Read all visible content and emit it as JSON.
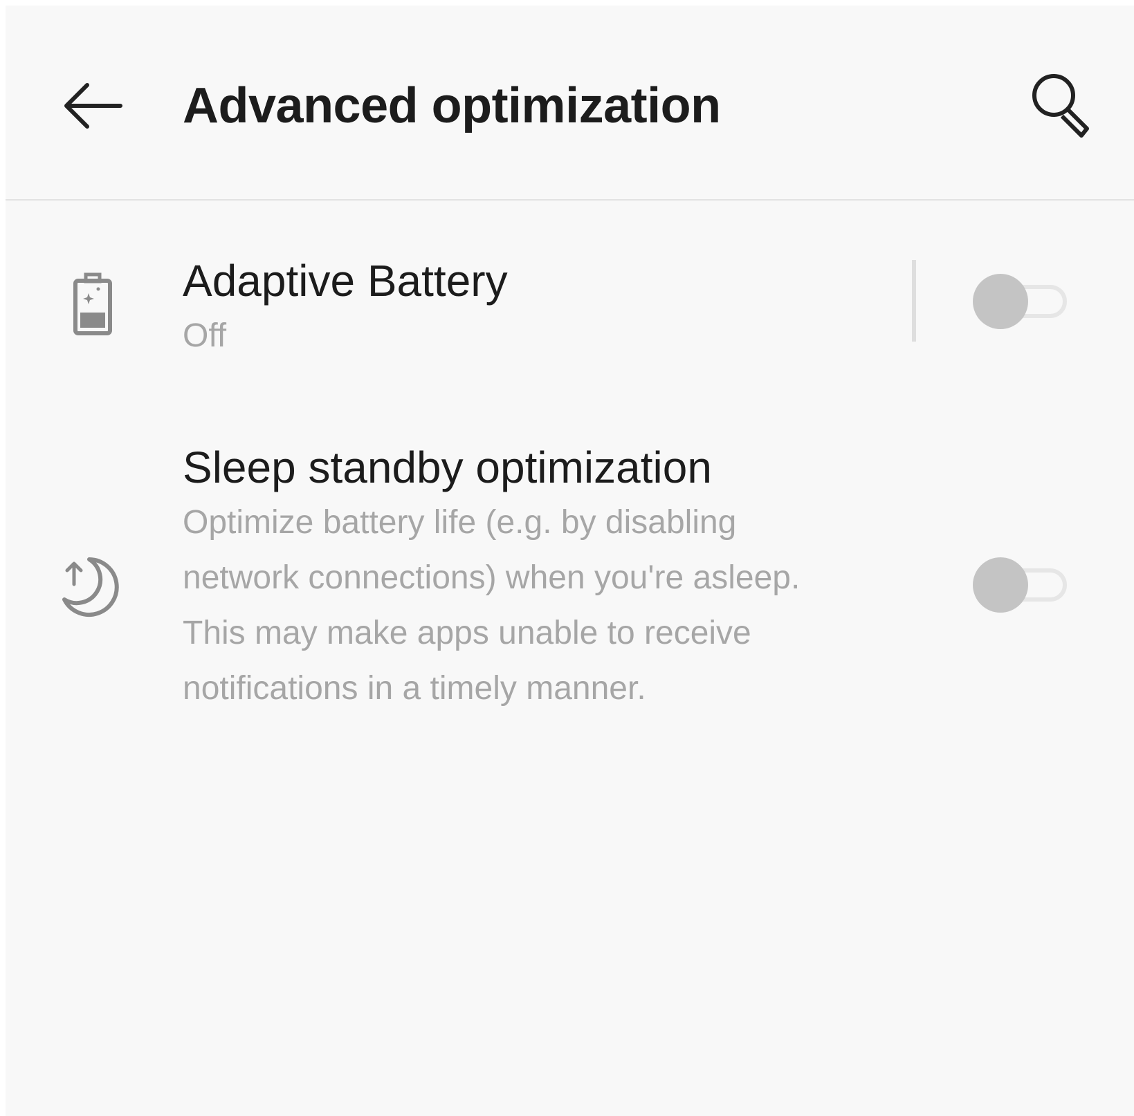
{
  "appbar": {
    "title": "Advanced optimization",
    "back_icon": "arrow-left-icon",
    "search_icon": "search-icon"
  },
  "settings": [
    {
      "title": "Adaptive Battery",
      "summary": "Off",
      "icon": "battery-icon",
      "toggle_on": false
    },
    {
      "title": "Sleep standby optimization",
      "summary_lines": [
        "Optimize battery life (e.g. by disabling",
        "network connections) when you're asleep.",
        "This may make apps unable to receive",
        "notifications in a timely manner."
      ],
      "icon": "moon-icon",
      "toggle_on": false
    }
  ],
  "colors": {
    "background": "#f8f8f8",
    "title_text": "#1c1c1c",
    "summary_text": "#a6a6a6",
    "switch_thumb_off": "#c4c4c4",
    "switch_track_off": "#e6e6e6"
  }
}
